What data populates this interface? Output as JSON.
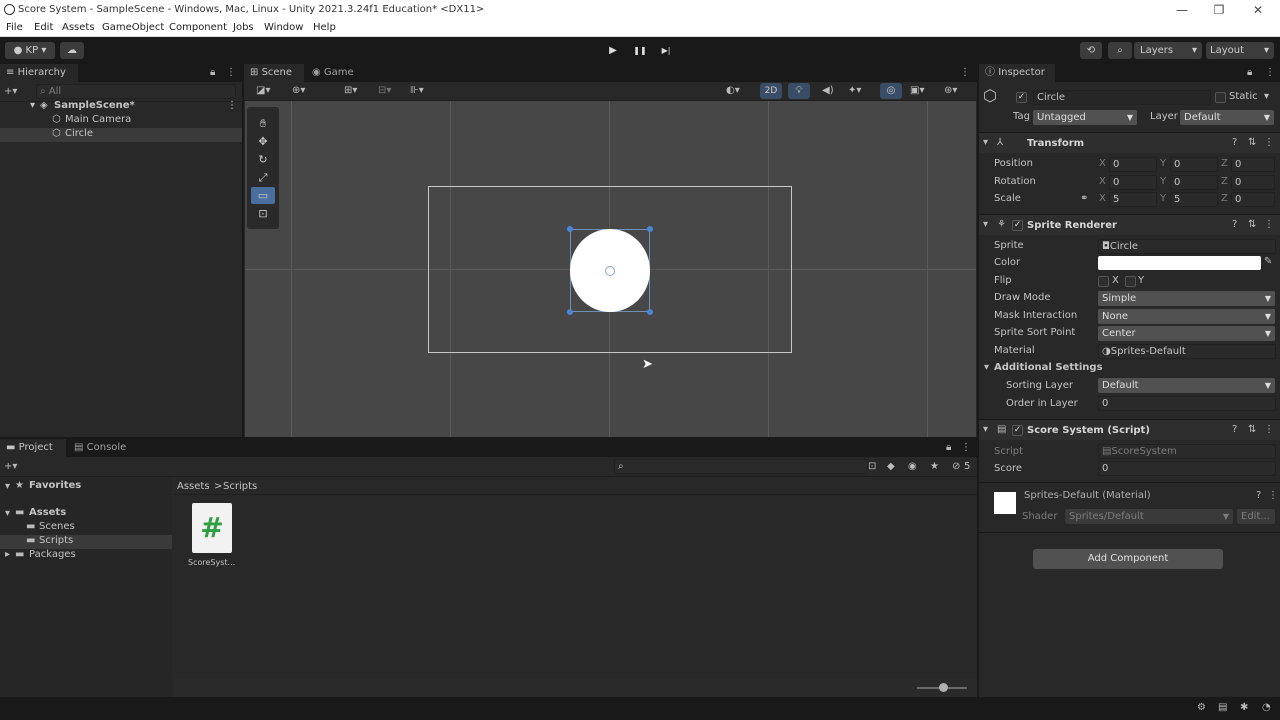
{
  "window": {
    "title": "Score System - SampleScene - Windows, Mac, Linux - Unity 2021.3.24f1 Education* <DX11>",
    "minimize": "—",
    "maximize": "❐",
    "close": "✕"
  },
  "menu": [
    "File",
    "Edit",
    "Assets",
    "GameObject",
    "Component",
    "Jobs",
    "Window",
    "Help"
  ],
  "toolbar": {
    "account_label": "KP",
    "play": "▶",
    "pause": "❚❚",
    "step": "▶|",
    "layers_label": "Layers",
    "layout_label": "Layout"
  },
  "hierarchy": {
    "tab_label": "Hierarchy",
    "search_placeholder": "All",
    "items": [
      {
        "label": "SampleScene*"
      },
      {
        "label": "Main Camera"
      },
      {
        "label": "Circle"
      }
    ]
  },
  "scene": {
    "tabs": [
      {
        "label": "Scene"
      },
      {
        "label": "Game"
      }
    ],
    "mode_2d": "2D"
  },
  "inspector": {
    "tab_label": "Inspector",
    "object_name": "Circle",
    "static_label": "Static",
    "tag_label": "Tag",
    "tag_value": "Untagged",
    "layer_label": "Layer",
    "layer_value": "Default",
    "transform": {
      "title": "Transform",
      "rows": [
        {
          "label": "Position",
          "x": "0",
          "y": "0",
          "z": "0"
        },
        {
          "label": "Rotation",
          "x": "0",
          "y": "0",
          "z": "0"
        },
        {
          "label": "Scale",
          "x": "5",
          "y": "5",
          "z": "0"
        }
      ]
    },
    "sprite_renderer": {
      "title": "Sprite Renderer",
      "sprite_label": "Sprite",
      "sprite_value": "Circle",
      "color_label": "Color",
      "color_value": "#ffffff",
      "flip_label": "Flip",
      "flip_x": "X",
      "flip_y": "Y",
      "draw_mode_label": "Draw Mode",
      "draw_mode_value": "Simple",
      "mask_label": "Mask Interaction",
      "mask_value": "None",
      "sort_point_label": "Sprite Sort Point",
      "sort_point_value": "Center",
      "material_label": "Material",
      "material_value": "Sprites-Default",
      "additional_label": "Additional Settings",
      "sorting_layer_label": "Sorting Layer",
      "sorting_layer_value": "Default",
      "order_label": "Order in Layer",
      "order_value": "0"
    },
    "score_system": {
      "title": "Score System (Script)",
      "script_label": "Script",
      "script_value": "ScoreSystem",
      "score_label": "Score",
      "score_value": "0"
    },
    "material": {
      "title": "Sprites-Default (Material)",
      "shader_label": "Shader",
      "shader_value": "Sprites/Default",
      "edit_label": "Edit..."
    },
    "add_component": "Add Component"
  },
  "project": {
    "tabs": [
      {
        "label": "Project"
      },
      {
        "label": "Console"
      }
    ],
    "favorites": "Favorites",
    "tree": [
      {
        "label": "Assets"
      },
      {
        "label": "Scenes"
      },
      {
        "label": "Scripts"
      },
      {
        "label": "Packages"
      }
    ],
    "breadcrumb": [
      "Assets",
      "Scripts"
    ],
    "breadcrumb_sep": ">",
    "asset": {
      "label": "ScoreSyst...",
      "glyph": "#"
    },
    "hidden_count": "5"
  },
  "colors": {
    "editor_bg": "#282828",
    "scene_bg": "#474747",
    "selection": "#2c4463",
    "accent": "#4a6f9e"
  }
}
